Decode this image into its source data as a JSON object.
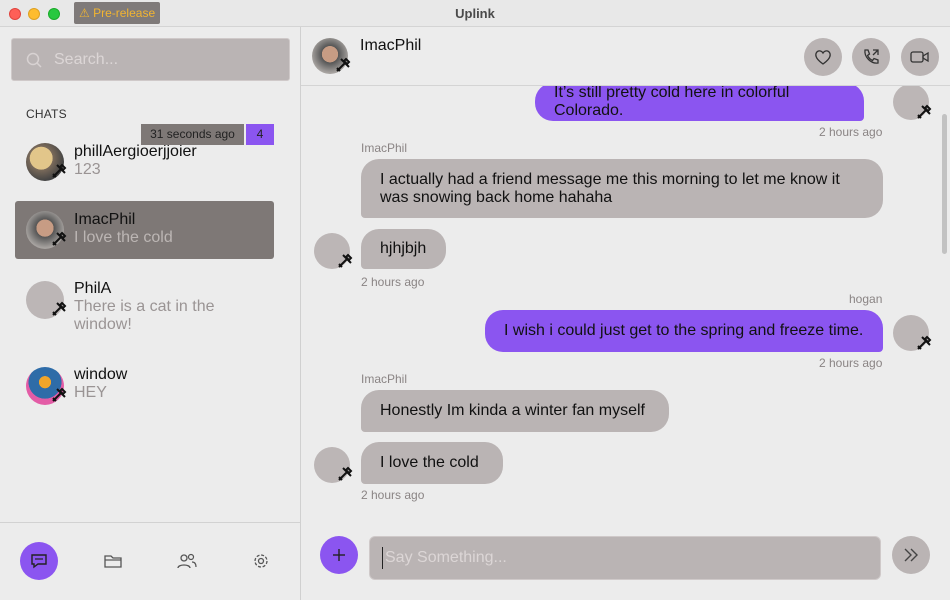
{
  "window": {
    "title": "Uplink",
    "badge": "⚠ Pre-release"
  },
  "sidebar": {
    "search_placeholder": "Search...",
    "chats_heading": "CHATS",
    "chats": [
      {
        "name": "phillAergioerjjoier",
        "preview": "123",
        "time": "31 seconds ago",
        "unread": "4",
        "avatar": "photo-avatar"
      },
      {
        "name": "ImacPhil",
        "preview": "I love the cold",
        "active": true,
        "avatar": "photo-avatar"
      },
      {
        "name": "PhilA",
        "preview": "There is a cat in the window!",
        "avatar": "generic-avatar"
      },
      {
        "name": "window",
        "preview": "HEY",
        "avatar": "photo-avatar"
      }
    ],
    "nav": [
      "chat-icon",
      "folder-icon",
      "friends-icon",
      "settings-icon"
    ]
  },
  "header": {
    "name": "ImacPhil",
    "buttons": [
      "heart-icon",
      "call-icon",
      "video-icon"
    ]
  },
  "messages": [
    {
      "direction": "out",
      "text": "It’s still pretty cold here in colorful Colorado.",
      "time": "2 hours ago"
    },
    {
      "direction": "in",
      "sender": "ImacPhil",
      "text": "I actually had a friend message me this morning to let me know it was snowing back home hahaha"
    },
    {
      "direction": "in",
      "text": "hjhjbjh",
      "time": "2 hours ago"
    },
    {
      "direction": "out",
      "sender": "hogan",
      "text": "I wish i could just get to the spring and freeze time.",
      "time": "2 hours ago"
    },
    {
      "direction": "in",
      "sender": "ImacPhil",
      "text": "Honestly Im kinda a winter fan myself"
    },
    {
      "direction": "in",
      "text": "I love the cold",
      "time": "2 hours ago"
    }
  ],
  "composer": {
    "placeholder": "Say Something..."
  },
  "colors": {
    "accent": "#8b55f0",
    "bubble_in": "#bab4b4",
    "prerelease_text": "#f2b531"
  }
}
